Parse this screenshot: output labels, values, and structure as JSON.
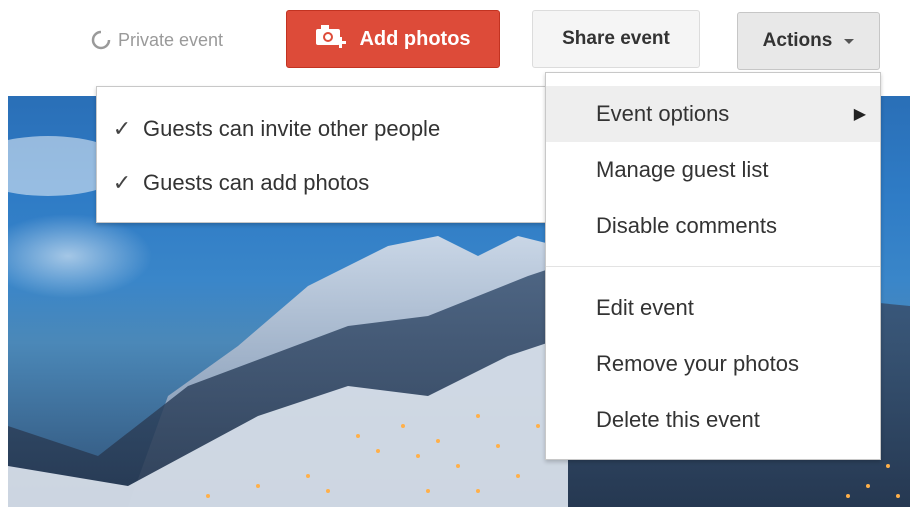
{
  "toolbar": {
    "privacy_label": "Private event",
    "add_photos_label": "Add photos",
    "share_label": "Share event",
    "actions_label": "Actions"
  },
  "submenu": {
    "items": [
      {
        "label": "Guests can invite other people",
        "checked": true
      },
      {
        "label": "Guests can add photos",
        "checked": true
      }
    ]
  },
  "actions_menu": {
    "items": [
      {
        "label": "Event options",
        "has_submenu": true,
        "highlighted": true
      },
      {
        "label": "Manage guest list"
      },
      {
        "label": "Disable comments"
      },
      {
        "label": "Edit event"
      },
      {
        "label": "Remove your photos"
      },
      {
        "label": "Delete this event"
      }
    ]
  },
  "icons": {
    "privacy": "private-circle-icon",
    "add_photos": "camera-plus-icon",
    "check": "checkmark-icon",
    "submenu_arrow": "triangle-right-icon",
    "dropdown": "caret-down-icon"
  },
  "colors": {
    "add_photos_bg": "#dd4b39",
    "menu_highlight": "#eeeeee"
  }
}
